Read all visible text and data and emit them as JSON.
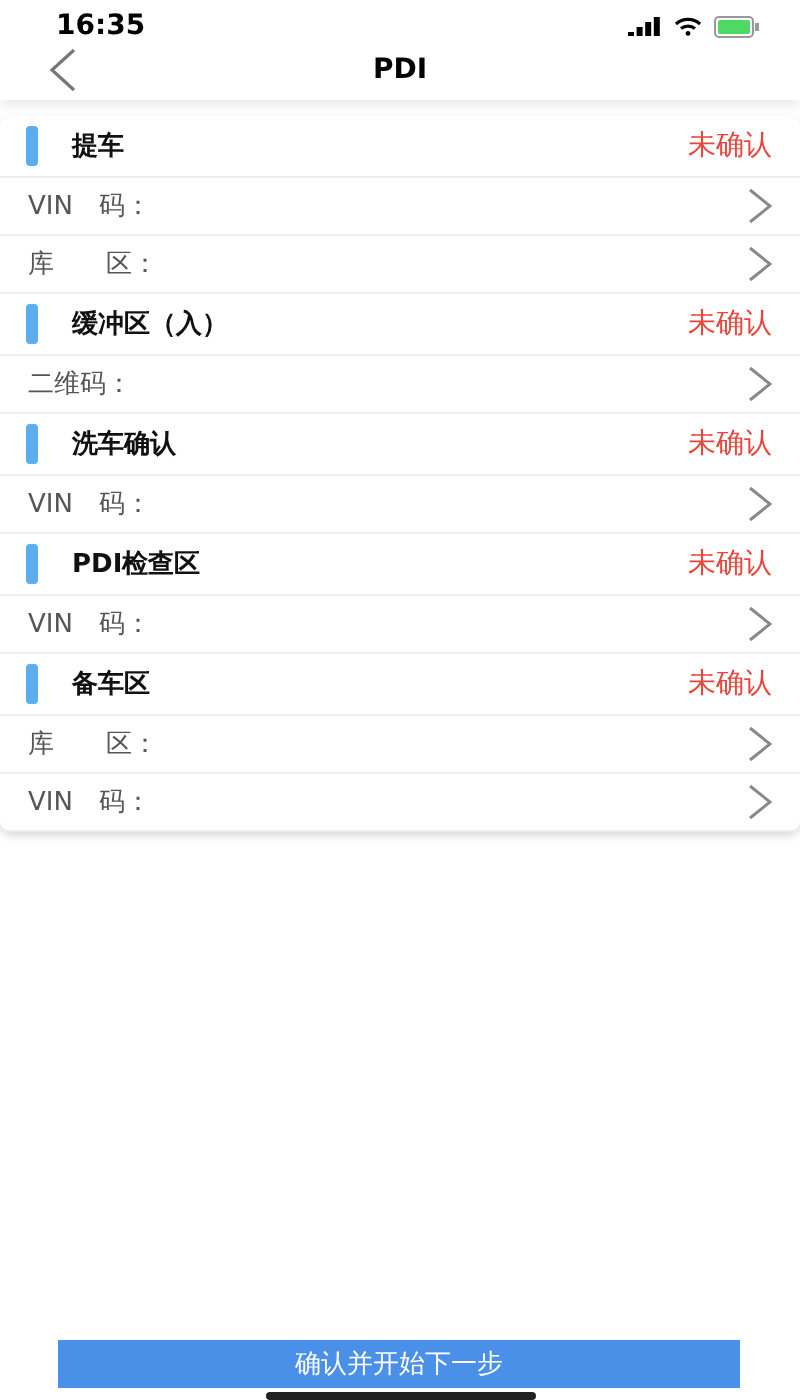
{
  "status_bar": {
    "time": "16:35"
  },
  "nav": {
    "title": "PDI"
  },
  "sections": [
    {
      "title": "提车",
      "status": "未确认",
      "fields": [
        {
          "label": "VIN　码："
        },
        {
          "label": "库　　区："
        }
      ]
    },
    {
      "title": "缓冲区（入）",
      "status": "未确认",
      "fields": [
        {
          "label": "二维码："
        }
      ]
    },
    {
      "title": "洗车确认",
      "status": "未确认",
      "fields": [
        {
          "label": "VIN　码："
        }
      ]
    },
    {
      "title": "PDI检查区",
      "status": "未确认",
      "fields": [
        {
          "label": "VIN　码："
        }
      ]
    },
    {
      "title": "备车区",
      "status": "未确认",
      "fields": [
        {
          "label": "库　　区："
        },
        {
          "label": "VIN　码："
        }
      ]
    }
  ],
  "button": "确认并开始下一步"
}
